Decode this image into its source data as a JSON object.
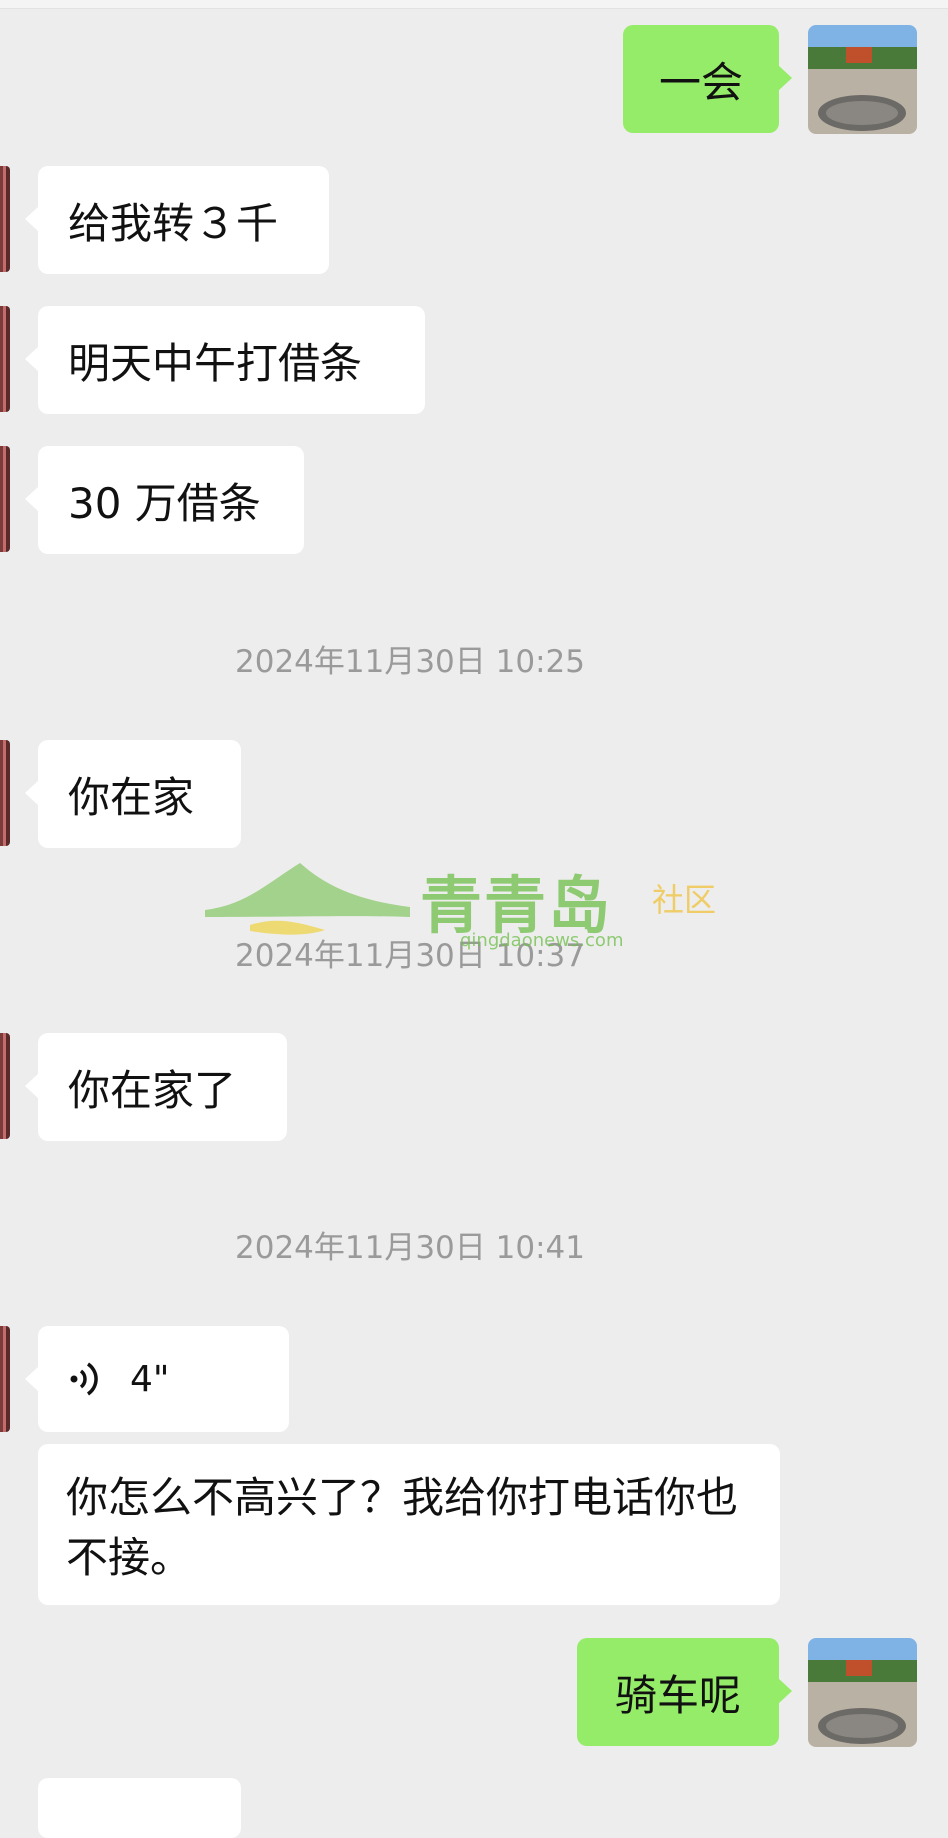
{
  "messages": {
    "m1": "一会",
    "m2": "给我转３千",
    "m3": "明天中午打借条",
    "m4": "30 万借条",
    "m5": "你在家",
    "m6": "你在家了",
    "m7_duration": "4\"",
    "m8": "你怎么不高兴了？我给你打电话你也不接。",
    "m9": "骑车呢"
  },
  "timestamps": {
    "t1": "2024年11月30日 10:25",
    "t2": "2024年11月30日 10:37",
    "t3": "2024年11月30日 10:41"
  },
  "watermark": {
    "brand": "青青岛",
    "tag": "社区",
    "url": "qingdaonews.com"
  },
  "colors": {
    "background": "#ededed",
    "incoming_bubble": "#ffffff",
    "outgoing_bubble": "#95ec69",
    "timestamp_text": "#9a9a9a"
  }
}
